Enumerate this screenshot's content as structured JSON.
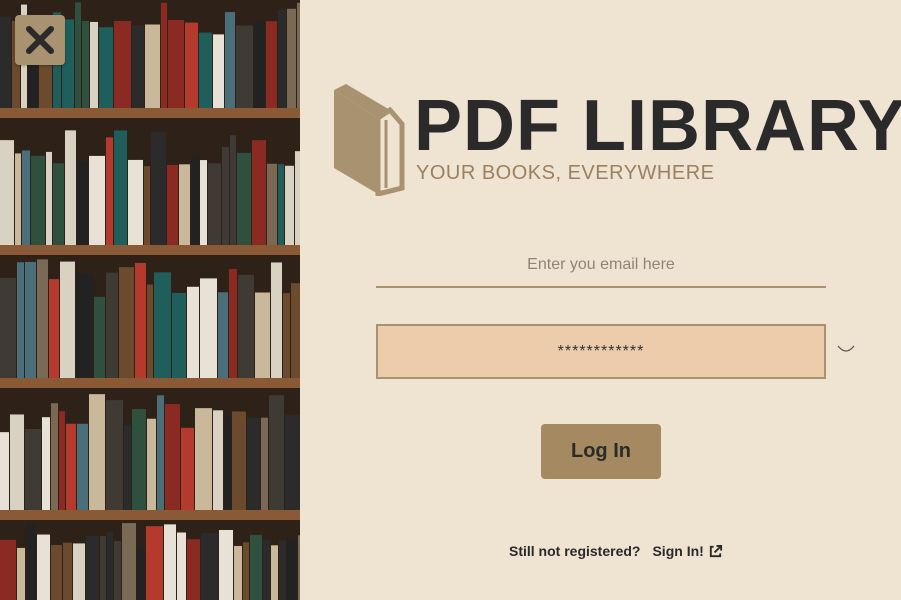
{
  "brand": {
    "title": "PDF LIBRARY",
    "tagline": "YOUR BOOKS, EVERYWHERE",
    "colors": {
      "dark": "#2a2a2a",
      "accent": "#a8926f",
      "tagline": "#9b8061",
      "background": "#efe3d2",
      "password_fill": "#ecccab"
    }
  },
  "close": {
    "icon": "close-icon"
  },
  "form": {
    "email": {
      "placeholder": "Enter you email here",
      "value": ""
    },
    "password": {
      "value": "************",
      "toggle_icon": "eye-icon"
    },
    "login_label": "Log In"
  },
  "footer": {
    "question": "Still not registered?",
    "signin_label": "Sign In!",
    "signin_icon": "external-link-icon"
  }
}
